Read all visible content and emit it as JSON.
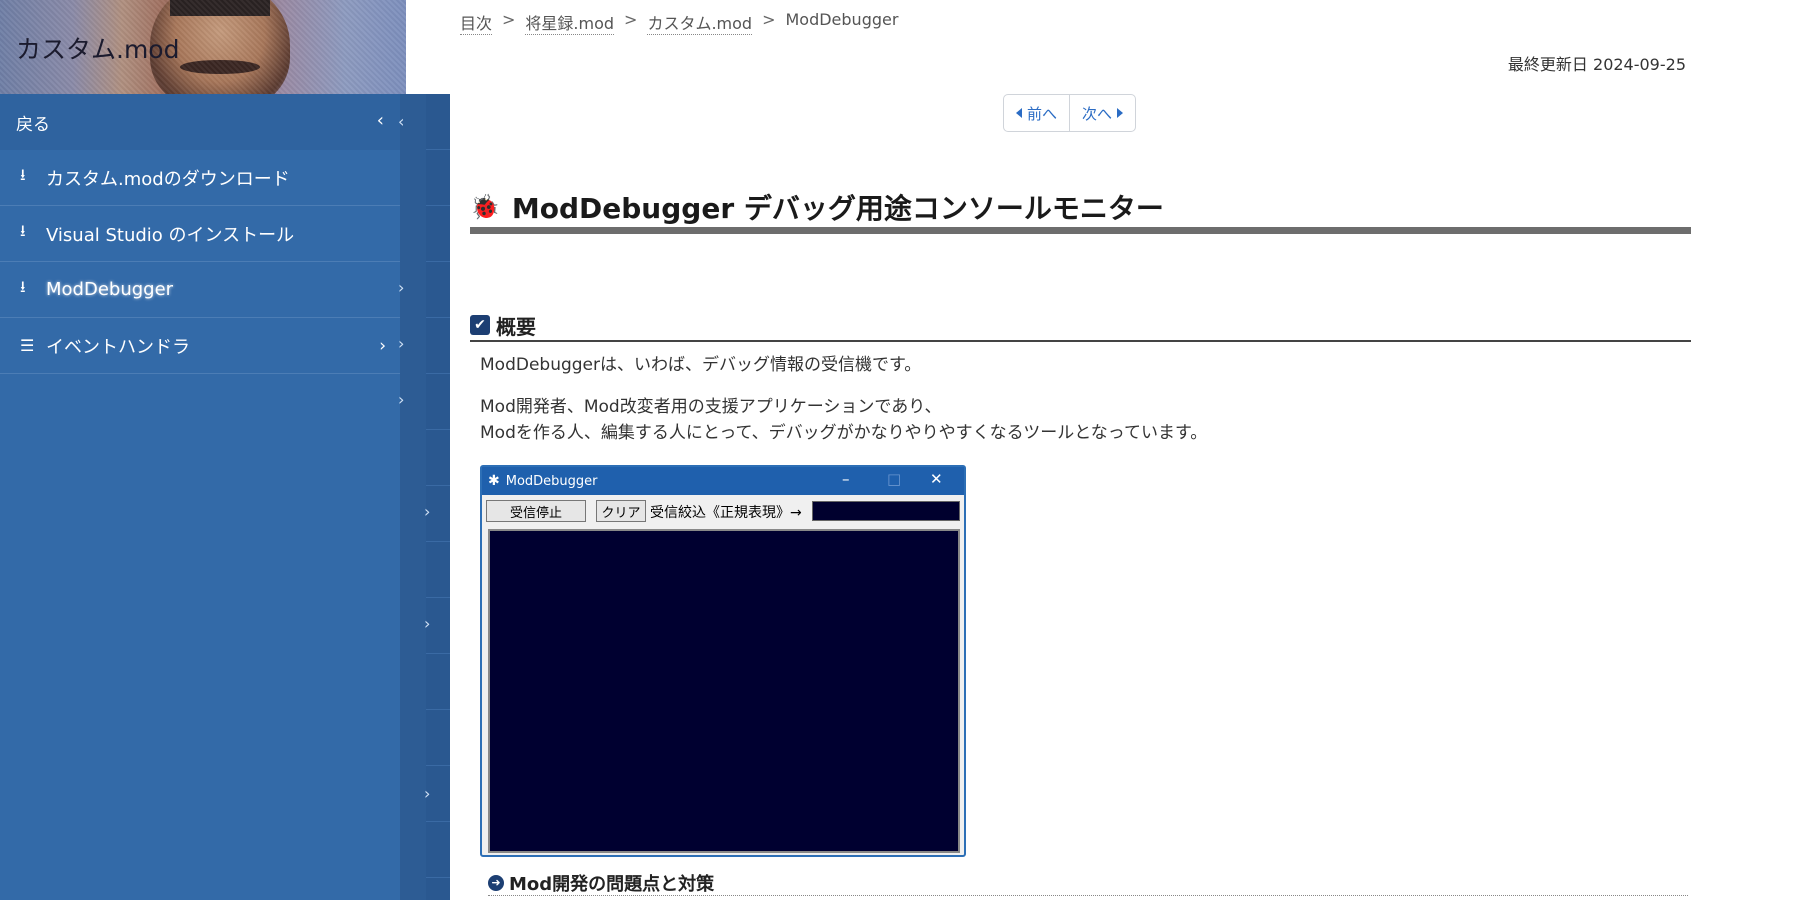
{
  "site": {
    "title": "カスタム.mod"
  },
  "sidebar": {
    "back_label": "戻る",
    "items": [
      {
        "label": "カスタム.modのダウンロード",
        "icon": "download-icon"
      },
      {
        "label": "Visual Studio のインストール",
        "icon": "download-icon"
      },
      {
        "label": "ModDebugger",
        "icon": "download-icon",
        "active": true
      },
      {
        "label": "イベントハンドラ",
        "icon": "list-icon"
      }
    ]
  },
  "breadcrumb": {
    "items": [
      "目次",
      "将星録.mod",
      "カスタム.mod"
    ],
    "current": "ModDebugger",
    "separator": ">"
  },
  "updated": "最終更新日 2024-09-25",
  "pager": {
    "prev": "前へ",
    "next": "次へ"
  },
  "page": {
    "title": "ModDebugger デバッグ用途コンソールモニター",
    "section1": "概要",
    "para1": "ModDebuggerは、いわば、デバッグ情報の受信機です。",
    "para2_line1": "Mod開発者、Mod改変者用の支援アプリケーションであり、",
    "para2_line2": "Modを作る人、編集する人にとって、デバッグがかなりやりやすくなるツールとなっています。",
    "subsection1": "Mod開発の問題点と対策"
  },
  "app_window": {
    "title": "ModDebugger",
    "stop_button": "受信停止",
    "clear_button": "クリア",
    "filter_label": "受信絞込《正規表現》→",
    "filter_value": ""
  },
  "colors": {
    "sidebar": "#336aa8",
    "accent": "#2b6cc4",
    "console_bg": "#000030"
  }
}
